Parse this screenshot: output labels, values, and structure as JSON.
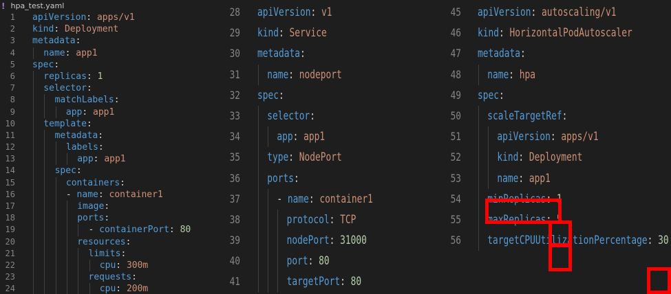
{
  "file_tab": {
    "icon": "!",
    "name": "hpa_test.yaml"
  },
  "panels": [
    {
      "id": "panel-1",
      "lines": [
        {
          "n": "1",
          "i": 0,
          "t": [
            [
              "k",
              "apiVersion"
            ],
            [
              "p",
              ": "
            ],
            [
              "s",
              "apps/v1"
            ]
          ]
        },
        {
          "n": "2",
          "i": 0,
          "t": [
            [
              "k",
              "kind"
            ],
            [
              "p",
              ": "
            ],
            [
              "s",
              "Deployment"
            ]
          ]
        },
        {
          "n": "3",
          "i": 0,
          "t": [
            [
              "k",
              "metadata"
            ],
            [
              "p",
              ":"
            ]
          ]
        },
        {
          "n": "4",
          "i": 1,
          "t": [
            [
              "k",
              "name"
            ],
            [
              "p",
              ": "
            ],
            [
              "s",
              "app1"
            ]
          ]
        },
        {
          "n": "5",
          "i": 0,
          "t": [
            [
              "k",
              "spec"
            ],
            [
              "p",
              ":"
            ]
          ]
        },
        {
          "n": "6",
          "i": 1,
          "t": [
            [
              "k",
              "replicas"
            ],
            [
              "p",
              ": "
            ],
            [
              "n",
              "1"
            ]
          ]
        },
        {
          "n": "7",
          "i": 1,
          "t": [
            [
              "k",
              "selector"
            ],
            [
              "p",
              ":"
            ]
          ]
        },
        {
          "n": "8",
          "i": 2,
          "t": [
            [
              "k",
              "matchLabels"
            ],
            [
              "p",
              ":"
            ]
          ]
        },
        {
          "n": "9",
          "i": 3,
          "t": [
            [
              "k",
              "app"
            ],
            [
              "p",
              ": "
            ],
            [
              "s",
              "app1"
            ]
          ]
        },
        {
          "n": "10",
          "i": 1,
          "t": [
            [
              "k",
              "template"
            ],
            [
              "p",
              ":"
            ]
          ]
        },
        {
          "n": "11",
          "i": 2,
          "t": [
            [
              "k",
              "metadata"
            ],
            [
              "p",
              ":"
            ]
          ]
        },
        {
          "n": "12",
          "i": 3,
          "t": [
            [
              "k",
              "labels"
            ],
            [
              "p",
              ":"
            ]
          ]
        },
        {
          "n": "13",
          "i": 4,
          "t": [
            [
              "k",
              "app"
            ],
            [
              "p",
              ": "
            ],
            [
              "s",
              "app1"
            ]
          ]
        },
        {
          "n": "14",
          "i": 2,
          "t": [
            [
              "k",
              "spec"
            ],
            [
              "p",
              ":"
            ]
          ]
        },
        {
          "n": "15",
          "i": 3,
          "t": [
            [
              "k",
              "containers"
            ],
            [
              "p",
              ":"
            ]
          ]
        },
        {
          "n": "16",
          "i": 3,
          "t": [
            [
              "p",
              "- "
            ],
            [
              "k",
              "name"
            ],
            [
              "p",
              ": "
            ],
            [
              "s",
              "container1"
            ]
          ]
        },
        {
          "n": "17",
          "i": 4,
          "t": [
            [
              "k",
              "image"
            ],
            [
              "p",
              ":"
            ]
          ]
        },
        {
          "n": "18",
          "i": 4,
          "t": [
            [
              "k",
              "ports"
            ],
            [
              "p",
              ":"
            ]
          ]
        },
        {
          "n": "19",
          "i": 5,
          "t": [
            [
              "p",
              "- "
            ],
            [
              "k",
              "containerPort"
            ],
            [
              "p",
              ": "
            ],
            [
              "n",
              "80"
            ]
          ]
        },
        {
          "n": "20",
          "i": 4,
          "t": [
            [
              "k",
              "resources"
            ],
            [
              "p",
              ":"
            ]
          ]
        },
        {
          "n": "21",
          "i": 5,
          "t": [
            [
              "k",
              "limits"
            ],
            [
              "p",
              ":"
            ]
          ]
        },
        {
          "n": "22",
          "i": 6,
          "t": [
            [
              "k",
              "cpu"
            ],
            [
              "p",
              ": "
            ],
            [
              "s",
              "300m"
            ]
          ]
        },
        {
          "n": "23",
          "i": 5,
          "t": [
            [
              "k",
              "requests"
            ],
            [
              "p",
              ":"
            ]
          ]
        },
        {
          "n": "24",
          "i": 6,
          "t": [
            [
              "k",
              "cpu"
            ],
            [
              "p",
              ": "
            ],
            [
              "s",
              "200m"
            ]
          ]
        }
      ]
    },
    {
      "id": "panel-2",
      "lines": [
        {
          "n": "28",
          "i": 0,
          "t": [
            [
              "k",
              "apiVersion"
            ],
            [
              "p",
              ": "
            ],
            [
              "s",
              "v1"
            ]
          ]
        },
        {
          "n": "29",
          "i": 0,
          "t": [
            [
              "k",
              "kind"
            ],
            [
              "p",
              ": "
            ],
            [
              "s",
              "Service"
            ]
          ]
        },
        {
          "n": "30",
          "i": 0,
          "t": [
            [
              "k",
              "metadata"
            ],
            [
              "p",
              ":"
            ]
          ]
        },
        {
          "n": "31",
          "i": 1,
          "t": [
            [
              "k",
              "name"
            ],
            [
              "p",
              ": "
            ],
            [
              "s",
              "nodeport"
            ]
          ]
        },
        {
          "n": "32",
          "i": 0,
          "t": [
            [
              "k",
              "spec"
            ],
            [
              "p",
              ":"
            ]
          ]
        },
        {
          "n": "33",
          "i": 1,
          "t": [
            [
              "k",
              "selector"
            ],
            [
              "p",
              ":"
            ]
          ]
        },
        {
          "n": "34",
          "i": 2,
          "t": [
            [
              "k",
              "app"
            ],
            [
              "p",
              ": "
            ],
            [
              "s",
              "app1"
            ]
          ]
        },
        {
          "n": "35",
          "i": 1,
          "t": [
            [
              "k",
              "type"
            ],
            [
              "p",
              ": "
            ],
            [
              "s",
              "NodePort"
            ]
          ]
        },
        {
          "n": "36",
          "i": 1,
          "t": [
            [
              "k",
              "ports"
            ],
            [
              "p",
              ":"
            ]
          ]
        },
        {
          "n": "37",
          "i": 2,
          "t": [
            [
              "p",
              "- "
            ],
            [
              "k",
              "name"
            ],
            [
              "p",
              ": "
            ],
            [
              "s",
              "container1"
            ]
          ]
        },
        {
          "n": "38",
          "i": 3,
          "t": [
            [
              "k",
              "protocol"
            ],
            [
              "p",
              ": "
            ],
            [
              "s",
              "TCP"
            ]
          ]
        },
        {
          "n": "39",
          "i": 3,
          "t": [
            [
              "k",
              "nodePort"
            ],
            [
              "p",
              ": "
            ],
            [
              "n",
              "31000"
            ]
          ]
        },
        {
          "n": "40",
          "i": 3,
          "t": [
            [
              "k",
              "port"
            ],
            [
              "p",
              ": "
            ],
            [
              "n",
              "80"
            ]
          ]
        },
        {
          "n": "41",
          "i": 3,
          "t": [
            [
              "k",
              "targetPort"
            ],
            [
              "p",
              ": "
            ],
            [
              "n",
              "80"
            ]
          ]
        }
      ]
    },
    {
      "id": "panel-3",
      "lines": [
        {
          "n": "45",
          "i": 0,
          "t": [
            [
              "k",
              "apiVersion"
            ],
            [
              "p",
              ": "
            ],
            [
              "s",
              "autoscaling/v1"
            ]
          ]
        },
        {
          "n": "46",
          "i": 0,
          "t": [
            [
              "k",
              "kind"
            ],
            [
              "p",
              ": "
            ],
            [
              "s",
              "HorizontalPodAutoscaler"
            ]
          ]
        },
        {
          "n": "47",
          "i": 0,
          "t": [
            [
              "k",
              "metadata"
            ],
            [
              "p",
              ":"
            ]
          ]
        },
        {
          "n": "48",
          "i": 1,
          "t": [
            [
              "k",
              "name"
            ],
            [
              "p",
              ": "
            ],
            [
              "s",
              "hpa"
            ]
          ]
        },
        {
          "n": "49",
          "i": 0,
          "t": [
            [
              "k",
              "spec"
            ],
            [
              "p",
              ":"
            ]
          ]
        },
        {
          "n": "50",
          "i": 1,
          "t": [
            [
              "k",
              "scaleTargetRef"
            ],
            [
              "p",
              ":"
            ]
          ]
        },
        {
          "n": "51",
          "i": 2,
          "t": [
            [
              "k",
              "apiVersion"
            ],
            [
              "p",
              ": "
            ],
            [
              "s",
              "apps/v1"
            ]
          ]
        },
        {
          "n": "52",
          "i": 2,
          "t": [
            [
              "k",
              "kind"
            ],
            [
              "p",
              ": "
            ],
            [
              "s",
              "Deployment"
            ]
          ]
        },
        {
          "n": "53",
          "i": 2,
          "t": [
            [
              "k",
              "name"
            ],
            [
              "p",
              ": "
            ],
            [
              "s",
              "app1"
            ]
          ]
        },
        {
          "n": "54",
          "i": 1,
          "t": [
            [
              "k",
              "minReplicas"
            ],
            [
              "p",
              ": "
            ],
            [
              "n",
              "1"
            ]
          ]
        },
        {
          "n": "55",
          "i": 1,
          "t": [
            [
              "k",
              "maxReplicas"
            ],
            [
              "p",
              ": "
            ],
            [
              "n",
              "5"
            ]
          ]
        },
        {
          "n": "56",
          "i": 1,
          "t": [
            [
              "k",
              "targetCPUUtilizationPercentage"
            ],
            [
              "p",
              ": "
            ],
            [
              "n",
              "30"
            ]
          ]
        }
      ]
    }
  ],
  "highlight_color": "#ff0000",
  "token_colors": {
    "key": "#569cd6",
    "string": "#ce9178",
    "number": "#b5cea8",
    "punct": "#d4d4d4",
    "line_number": "#858585",
    "background": "#1e1e1e"
  }
}
